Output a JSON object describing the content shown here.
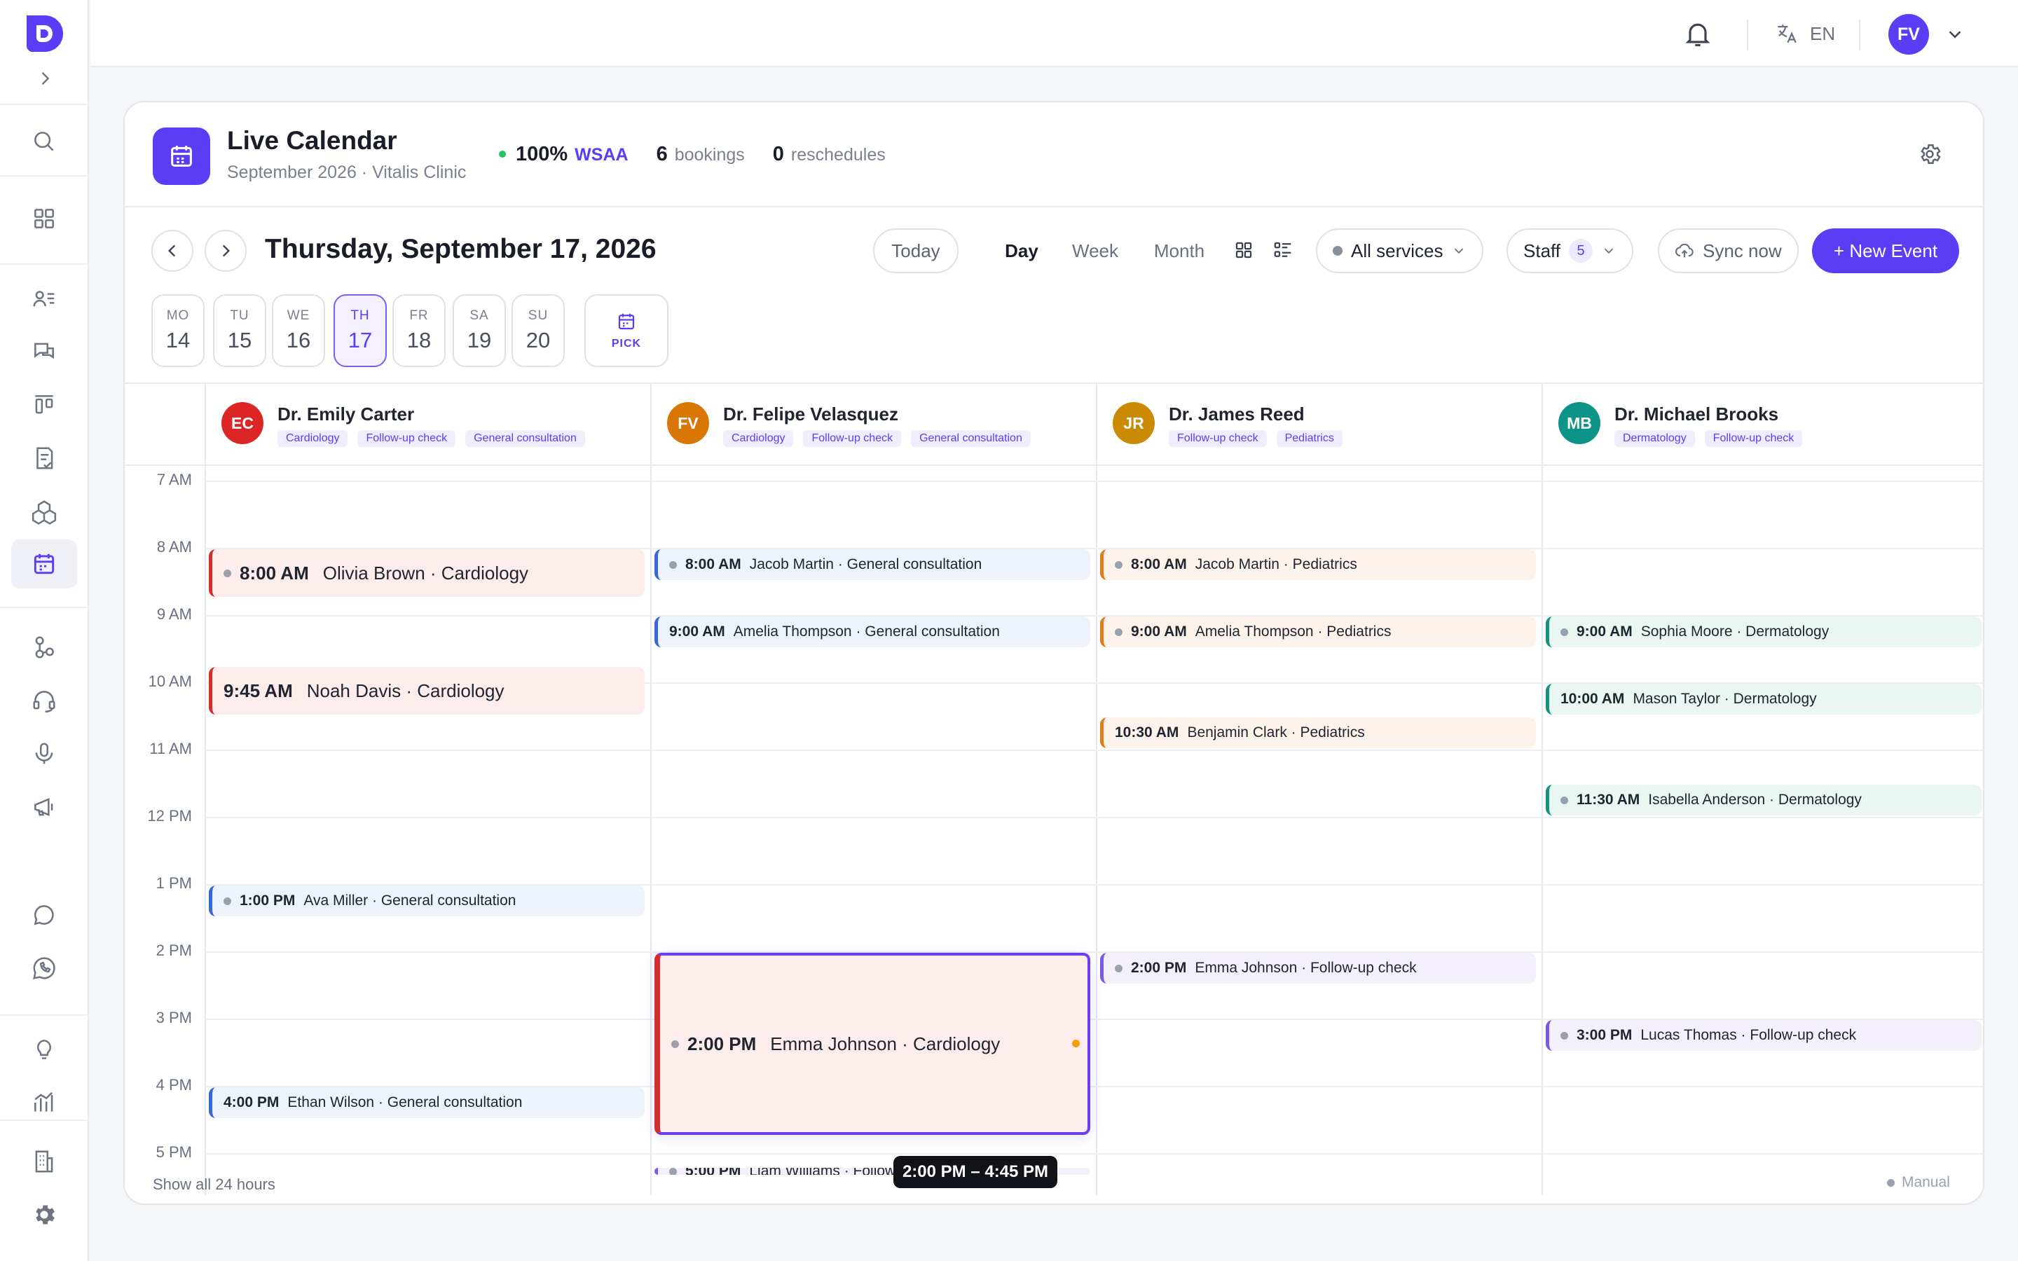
{
  "app": {
    "logo_icon": "app-logo",
    "accent": "#5b3df5"
  },
  "sidebar": {
    "items": [
      {
        "name": "search",
        "icon": "search-icon"
      },
      {
        "name": "dashboard",
        "icon": "grid-icon"
      },
      {
        "name": "contacts",
        "icon": "contacts-icon"
      },
      {
        "name": "messages",
        "icon": "chat-bubbles-icon"
      },
      {
        "name": "kanban",
        "icon": "kanban-icon"
      },
      {
        "name": "tasks",
        "icon": "checklist-icon"
      },
      {
        "name": "inventory",
        "icon": "boxes-icon"
      },
      {
        "name": "calendar",
        "icon": "calendar-icon",
        "active": true
      },
      {
        "name": "integrations",
        "icon": "nodes-icon"
      },
      {
        "name": "support",
        "icon": "headset-icon"
      },
      {
        "name": "voice",
        "icon": "microphone-icon"
      },
      {
        "name": "campaigns",
        "icon": "megaphone-icon"
      },
      {
        "name": "chat",
        "icon": "chat-icon"
      },
      {
        "name": "whatsapp",
        "icon": "whatsapp-icon"
      },
      {
        "name": "insights",
        "icon": "lightbulb-icon"
      },
      {
        "name": "analytics",
        "icon": "bar-chart-icon"
      },
      {
        "name": "organization",
        "icon": "building-icon"
      },
      {
        "name": "settings",
        "icon": "gear-icon"
      }
    ]
  },
  "topbar": {
    "language": "EN",
    "avatar_initials": "FV"
  },
  "header": {
    "title": "Live Calendar",
    "subtitle": "September 2026 · Vitalis Clinic",
    "wsaa_value": "100%",
    "wsaa_label": "WSAA",
    "bookings_value": "6",
    "bookings_label": "bookings",
    "reschedules_value": "0",
    "reschedules_label": "reschedules"
  },
  "toolbar": {
    "date_title": "Thursday, September 17, 2026",
    "today_label": "Today",
    "views": [
      "Day",
      "Week",
      "Month"
    ],
    "active_view": "Day",
    "services_label": "All services",
    "staff_label": "Staff",
    "staff_count": "5",
    "sync_label": "Sync now",
    "new_event_label": "+ New Event"
  },
  "week_days": [
    {
      "dow": "MO",
      "num": "14"
    },
    {
      "dow": "TU",
      "num": "15"
    },
    {
      "dow": "WE",
      "num": "16"
    },
    {
      "dow": "TH",
      "num": "17",
      "active": true
    },
    {
      "dow": "FR",
      "num": "18"
    },
    {
      "dow": "SA",
      "num": "19"
    },
    {
      "dow": "SU",
      "num": "20"
    }
  ],
  "pick_label": "PICK",
  "hours": [
    "7 AM",
    "8 AM",
    "9 AM",
    "10 AM",
    "11 AM",
    "12 PM",
    "1 PM",
    "2 PM",
    "3 PM",
    "4 PM",
    "5 PM"
  ],
  "staff": [
    {
      "initials": "EC",
      "name": "Dr. Emily Carter",
      "color": "#dc2626",
      "tags": [
        "Cardiology",
        "Follow-up check",
        "General consultation"
      ]
    },
    {
      "initials": "FV",
      "name": "Dr. Felipe Velasquez",
      "color": "#d97706",
      "tags": [
        "Cardiology",
        "Follow-up check",
        "General consultation"
      ]
    },
    {
      "initials": "JR",
      "name": "Dr. James Reed",
      "color": "#ca8a04",
      "tags": [
        "Follow-up check",
        "Pediatrics"
      ]
    },
    {
      "initials": "MB",
      "name": "Dr. Michael Brooks",
      "color": "#0d9488",
      "tags": [
        "Dermatology",
        "Follow-up check"
      ]
    }
  ],
  "events": [
    {
      "col": 0,
      "start": 8.0,
      "end": 8.75,
      "time": "8:00 AM",
      "text": "Olivia Brown · Cardiology",
      "color": "red",
      "big": true
    },
    {
      "col": 0,
      "start": 9.75,
      "end": 10.5,
      "time": "9:45 AM",
      "text": "Noah Davis · Cardiology",
      "color": "red",
      "big": true,
      "nodot": true
    },
    {
      "col": 0,
      "start": 13.0,
      "end": 13.5,
      "time": "1:00 PM",
      "text": "Ava Miller · General consultation",
      "color": "blue"
    },
    {
      "col": 0,
      "start": 16.0,
      "end": 16.5,
      "time": "4:00 PM",
      "text": "Ethan Wilson · General consultation",
      "color": "blue",
      "nodot": true
    },
    {
      "col": 1,
      "start": 8.0,
      "end": 8.5,
      "time": "8:00 AM",
      "text": "Jacob Martin · General consultation",
      "color": "blue"
    },
    {
      "col": 1,
      "start": 9.0,
      "end": 9.5,
      "time": "9:00 AM",
      "text": "Amelia Thompson · General consultation",
      "color": "blue",
      "nodot": true
    },
    {
      "col": 1,
      "start": 14.0,
      "end": 16.75,
      "time": "2:00 PM",
      "text": "Emma Johnson · Cardiology",
      "color": "red",
      "big": true,
      "selected": true
    },
    {
      "col": 1,
      "start": 17.2,
      "end": 17.7,
      "time": "5:00 PM",
      "text": "Liam Williams · Follow-up check",
      "color": "purple"
    },
    {
      "col": 2,
      "start": 8.0,
      "end": 8.5,
      "time": "8:00 AM",
      "text": "Jacob Martin · Pediatrics",
      "color": "orange"
    },
    {
      "col": 2,
      "start": 9.0,
      "end": 9.5,
      "time": "9:00 AM",
      "text": "Amelia Thompson · Pediatrics",
      "color": "orange"
    },
    {
      "col": 2,
      "start": 10.5,
      "end": 11.0,
      "time": "10:30 AM",
      "text": "Benjamin Clark · Pediatrics",
      "color": "orange",
      "nodot": true
    },
    {
      "col": 2,
      "start": 14.0,
      "end": 14.5,
      "time": "2:00 PM",
      "text": "Emma Johnson · Follow-up check",
      "color": "purple"
    },
    {
      "col": 3,
      "start": 9.0,
      "end": 9.5,
      "time": "9:00 AM",
      "text": "Sophia Moore · Dermatology",
      "color": "green"
    },
    {
      "col": 3,
      "start": 10.0,
      "end": 10.5,
      "time": "10:00 AM",
      "text": "Mason Taylor · Dermatology",
      "color": "green",
      "nodot": true
    },
    {
      "col": 3,
      "start": 11.5,
      "end": 12.0,
      "time": "11:30 AM",
      "text": "Isabella Anderson · Dermatology",
      "color": "green"
    },
    {
      "col": 3,
      "start": 15.0,
      "end": 15.5,
      "time": "3:00 PM",
      "text": "Lucas Thomas · Follow-up check",
      "color": "purple"
    }
  ],
  "tooltip": "2:00 PM – 4:45 PM",
  "footer": {
    "show_all": "Show all 24 hours",
    "mode": "Manual"
  }
}
